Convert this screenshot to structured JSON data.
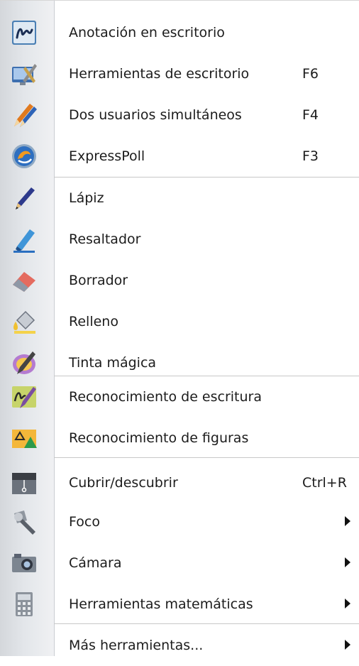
{
  "menu": {
    "items": [
      {
        "label": "Anotación en escritorio",
        "shortcut": "",
        "submenu": false,
        "icon": "desktop-annotation-icon"
      },
      {
        "label": "Herramientas de escritorio",
        "shortcut": "F6",
        "submenu": false,
        "icon": "desktop-tools-icon"
      },
      {
        "label": "Dos usuarios simultáneos",
        "shortcut": "F4",
        "submenu": false,
        "icon": "dual-user-pens-icon"
      },
      {
        "label": "ExpressPoll",
        "shortcut": "F3",
        "submenu": false,
        "icon": "expresspoll-icon"
      },
      {
        "label": "Lápiz",
        "shortcut": "",
        "submenu": false,
        "icon": "pen-icon"
      },
      {
        "label": "Resaltador",
        "shortcut": "",
        "submenu": false,
        "icon": "highlighter-icon"
      },
      {
        "label": "Borrador",
        "shortcut": "",
        "submenu": false,
        "icon": "eraser-icon"
      },
      {
        "label": "Relleno",
        "shortcut": "",
        "submenu": false,
        "icon": "fill-bucket-icon"
      },
      {
        "label": "Tinta mágica",
        "shortcut": "",
        "submenu": false,
        "icon": "magic-ink-icon"
      },
      {
        "label": "Reconocimiento de escritura",
        "shortcut": "",
        "submenu": false,
        "icon": "handwriting-recognition-icon"
      },
      {
        "label": "Reconocimiento de figuras",
        "shortcut": "",
        "submenu": false,
        "icon": "shape-recognition-icon"
      },
      {
        "label": "Cubrir/descubrir",
        "shortcut": "Ctrl+R",
        "submenu": false,
        "icon": "reveal-blind-icon"
      },
      {
        "label": "Foco",
        "shortcut": "",
        "submenu": true,
        "icon": "spotlight-icon"
      },
      {
        "label": "Cámara",
        "shortcut": "",
        "submenu": true,
        "icon": "camera-icon"
      },
      {
        "label": "Herramientas matemáticas",
        "shortcut": "",
        "submenu": true,
        "icon": "calculator-icon"
      },
      {
        "label": "Más herramientas...",
        "shortcut": "",
        "submenu": true,
        "icon": "more-tools-icon"
      }
    ]
  }
}
